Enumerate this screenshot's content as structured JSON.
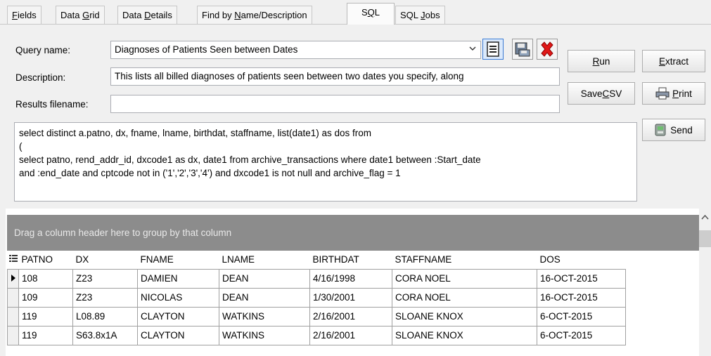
{
  "tabs": [
    {
      "label": "Fields",
      "u": "F",
      "rest": "ields",
      "active": false
    },
    {
      "label": "Data Grid",
      "pre": "Data ",
      "u": "G",
      "rest": "rid",
      "active": false
    },
    {
      "label": "Data Details",
      "pre": "Data ",
      "u": "D",
      "rest": "etails",
      "active": false
    },
    {
      "label": "Find by Name/Description",
      "pre": "Find by ",
      "u": "N",
      "rest": "ame/Description",
      "active": false
    },
    {
      "label": "SQL",
      "pre": "S",
      "u": "Q",
      "rest": "L",
      "active": true
    },
    {
      "label": "SQL Jobs",
      "pre": "SQL ",
      "u": "J",
      "rest": "obs",
      "active": false
    }
  ],
  "form": {
    "query_name_label": "Query name:",
    "query_name_value": "Diagnoses of Patients Seen between Dates",
    "description_label": "Description:",
    "description_value": "This lists all billed diagnoses of patients seen between two dates you specify, along",
    "results_label": "Results filename:",
    "results_value": ""
  },
  "toolbar_icons": [
    "open-query-icon",
    "save-query-icon",
    "delete-query-icon"
  ],
  "buttons": {
    "run": {
      "u": "R",
      "rest": "un"
    },
    "extract": {
      "u": "E",
      "rest": "xtract"
    },
    "save_csv": {
      "pre": "Save ",
      "u": "C",
      "rest": "SV"
    },
    "print": {
      "u": "P",
      "rest": "rint"
    },
    "send": {
      "label": "Send"
    }
  },
  "sql_text": "select distinct a.patno, dx, fname, lname, birthdat, staffname, list(date1) as dos from\n(\nselect patno, rend_addr_id, dxcode1 as dx, date1 from archive_transactions where date1 between :Start_date\nand :end_date and cptcode not in ('1','2','3','4') and dxcode1 is not null and archive_flag = 1",
  "grid": {
    "group_hint": "Drag a column header here to group by that column",
    "columns": [
      "PATNO",
      "DX",
      "FNAME",
      "LNAME",
      "BIRTHDAT",
      "STAFFNAME",
      "DOS"
    ],
    "rows": [
      [
        "108",
        "Z23",
        "DAMIEN",
        "DEAN",
        "4/16/1998",
        "CORA NOEL",
        "16-OCT-2015"
      ],
      [
        "109",
        "Z23",
        "NICOLAS",
        "DEAN",
        "1/30/2001",
        "CORA NOEL",
        "16-OCT-2015"
      ],
      [
        "119",
        "L08.89",
        "CLAYTON",
        "WATKINS",
        "2/16/2001",
        "SLOANE KNOX",
        "6-OCT-2015"
      ],
      [
        "119",
        "S63.8x1A",
        "CLAYTON",
        "WATKINS",
        "2/16/2001",
        "SLOANE KNOX",
        "6-OCT-2015"
      ]
    ],
    "current_row": 0
  }
}
